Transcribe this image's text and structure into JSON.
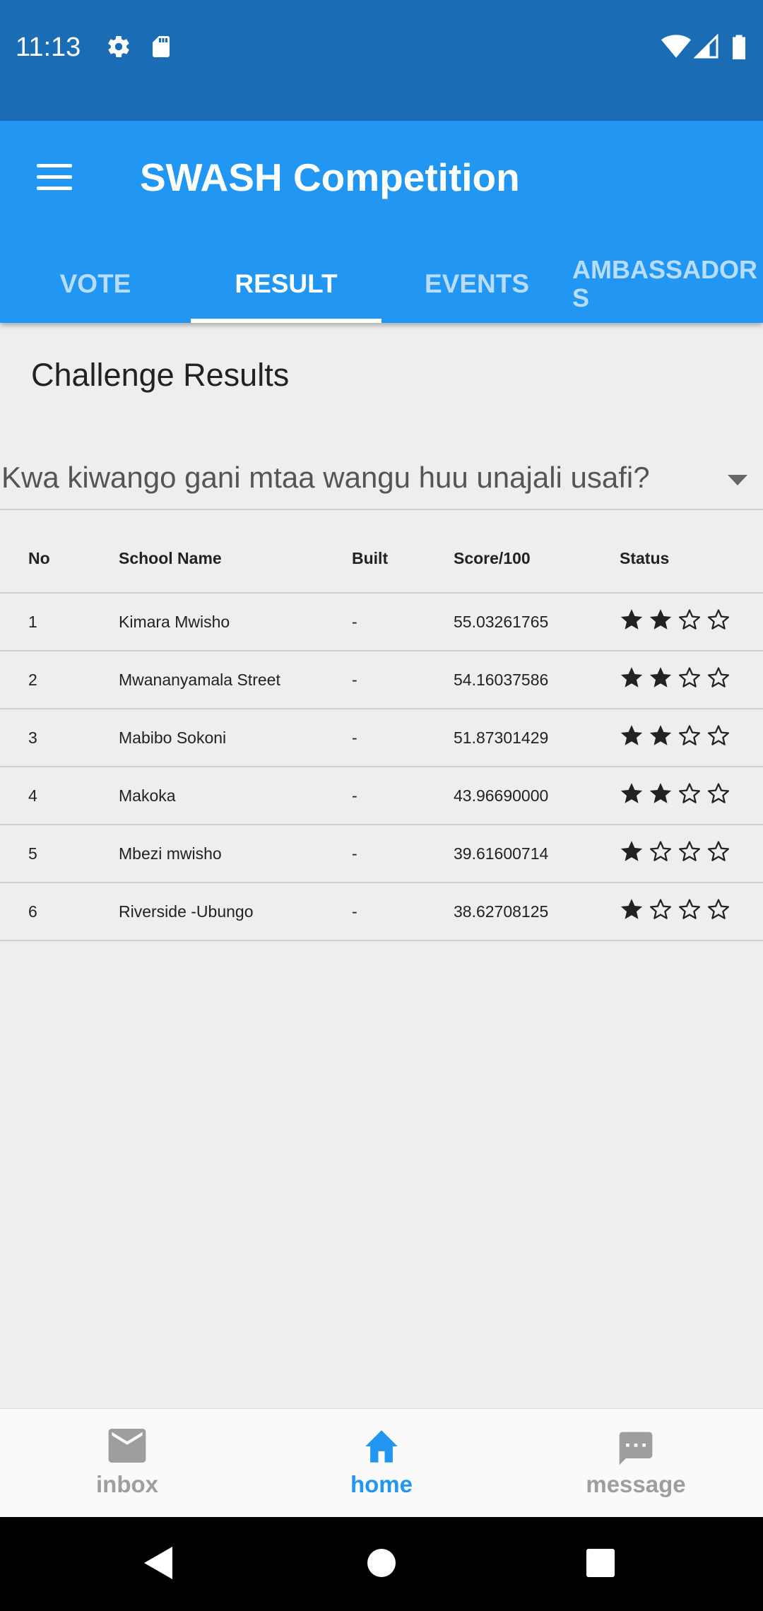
{
  "status_bar": {
    "time": "11:13",
    "icons": [
      "gear-icon",
      "sd-card-icon",
      "wifi-icon",
      "signal-icon",
      "battery-icon"
    ]
  },
  "app_bar": {
    "title": "SWASH Competition",
    "menu_icon": "hamburger-menu-icon",
    "background": "#2196f3"
  },
  "tabs": [
    {
      "label": "VOTE",
      "active": false
    },
    {
      "label": "RESULT",
      "active": true
    },
    {
      "label": "EVENTS",
      "active": false
    },
    {
      "label": "AMBASSADORS",
      "active": false
    }
  ],
  "main": {
    "section_title": "Challenge Results",
    "question_select": {
      "value": "Kwa kiwango gani mtaa wangu huu unajali usafi?"
    },
    "table": {
      "headers": [
        "No",
        "School Name",
        "Built",
        "Score/100",
        "Status"
      ],
      "rows": [
        {
          "no": "1",
          "name": "Kimara Mwisho",
          "built": "-",
          "score": "55.03261765",
          "stars": 2
        },
        {
          "no": "2",
          "name": "Mwananyamala Street",
          "built": "-",
          "score": "54.16037586",
          "stars": 2
        },
        {
          "no": "3",
          "name": "Mabibo Sokoni",
          "built": "-",
          "score": "51.87301429",
          "stars": 2
        },
        {
          "no": "4",
          "name": "Makoka",
          "built": "-",
          "score": "43.96690000",
          "stars": 2
        },
        {
          "no": "5",
          "name": "Mbezi mwisho",
          "built": "-",
          "score": "39.61600714",
          "stars": 1
        },
        {
          "no": "6",
          "name": "Riverside -Ubungo",
          "built": "-",
          "score": "38.62708125",
          "stars": 1
        }
      ],
      "max_stars": 4
    }
  },
  "bottom_nav": [
    {
      "label": "inbox",
      "icon": "mail-icon",
      "active": false
    },
    {
      "label": "home",
      "icon": "home-icon",
      "active": true
    },
    {
      "label": "message",
      "icon": "message-icon",
      "active": false
    }
  ],
  "colors": {
    "accent": "#2196f3",
    "status_bar": "#1a6db5",
    "inactive_nav": "#9e9e9e"
  }
}
